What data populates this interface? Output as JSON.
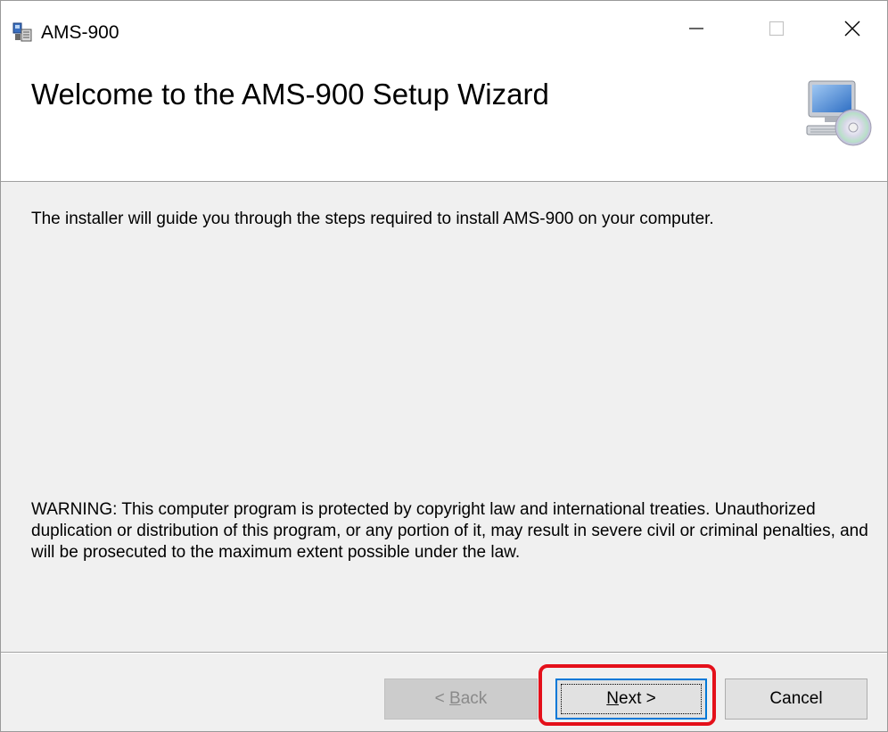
{
  "window": {
    "title": "AMS-900",
    "app_icon": "installer-icon",
    "controls": {
      "minimize": "minimize-icon",
      "maximize": "maximize-icon",
      "close": "close-icon"
    }
  },
  "banner": {
    "title": "Welcome to the AMS-900 Setup Wizard",
    "icon": "computer-cd-icon"
  },
  "content": {
    "intro": "The installer will guide you through the steps required to install AMS-900 on your computer.",
    "warning": "WARNING: This computer program is protected by copyright law and international treaties. Unauthorized duplication or distribution of this program, or any portion of it, may result in severe civil or criminal penalties, and will be prosecuted to the maximum extent possible under the law."
  },
  "buttons": {
    "back": {
      "prefix": "< ",
      "accel": "B",
      "rest": "ack",
      "enabled": false
    },
    "next": {
      "accel": "N",
      "rest": "ext >",
      "enabled": true,
      "focused": true
    },
    "cancel": {
      "label": "Cancel",
      "enabled": true
    }
  },
  "annotation": {
    "color": "#e4101a",
    "target": "next-button"
  },
  "colors": {
    "window_bg": "#f0f0f0",
    "focus_border": "#0078d7"
  }
}
